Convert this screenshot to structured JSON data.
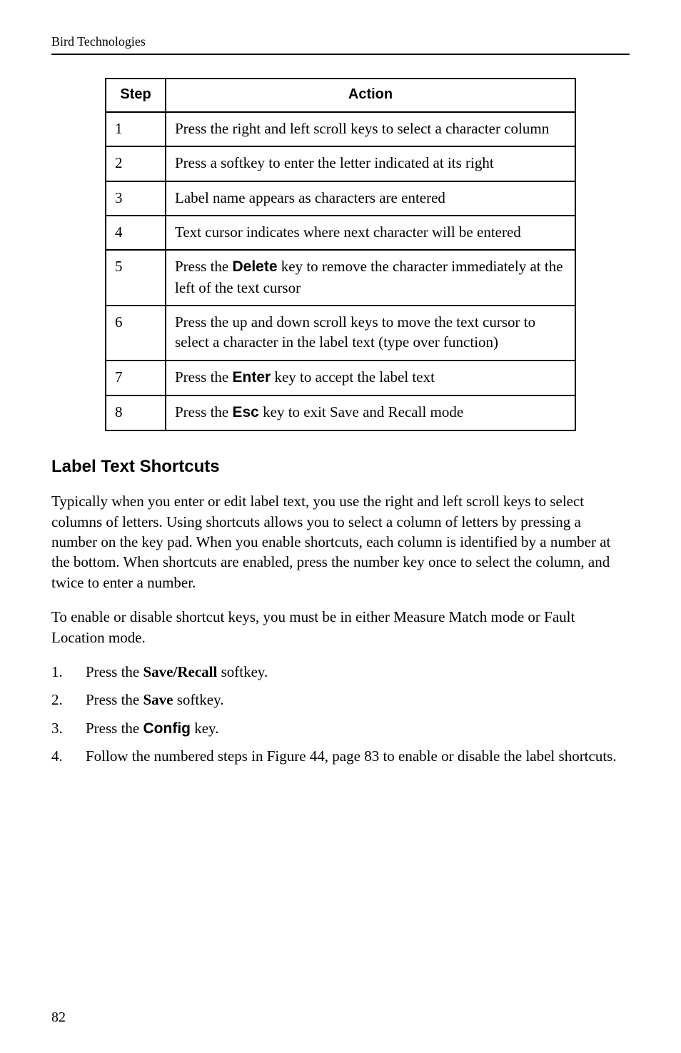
{
  "running_head": "Bird Technologies",
  "table": {
    "headers": {
      "step": "Step",
      "action": "Action"
    },
    "rows": [
      {
        "step": "1",
        "action_pre": "Press the right and left scroll keys to select a character column"
      },
      {
        "step": "2",
        "action_pre": "Press a softkey to enter the letter indicated at its right"
      },
      {
        "step": "3",
        "action_pre": "Label name appears as characters are entered"
      },
      {
        "step": "4",
        "action_pre": "Text cursor indicates where next character will be entered"
      },
      {
        "step": "5",
        "action_pre": "Press the ",
        "action_key": "Delete",
        "action_post": " key to remove the character immediately at the left of the text cursor"
      },
      {
        "step": "6",
        "action_pre": "Press the up and down scroll keys to move the text cursor to select a character in the label text (type over function)"
      },
      {
        "step": "7",
        "action_pre": "Press the ",
        "action_key": "Enter",
        "action_post": " key to accept the label text"
      },
      {
        "step": "8",
        "action_pre": "Press the ",
        "action_key": "Esc",
        "action_post": " key to exit Save and Recall mode"
      }
    ]
  },
  "section_heading": "Label Text Shortcuts",
  "para1": "Typically when you enter or edit label text, you use the right and left scroll keys to select columns of letters. Using shortcuts allows you to select a column of letters by pressing a number on the key pad. When you enable shortcuts, each column is identified by a number at the bottom. When shortcuts are enabled, press the number key once to select the column, and twice to enter a number.",
  "para2": "To enable or disable shortcut keys, you must be in either Measure Match mode or Fault Location mode.",
  "list": {
    "i1": {
      "pre": "Press the ",
      "key": "Save/Recall",
      "post": " softkey."
    },
    "i2": {
      "pre": "Press the ",
      "key": "Save",
      "post": " softkey."
    },
    "i3": {
      "pre": "Press the ",
      "key": "Config",
      "post": " key."
    },
    "i4": "Follow the numbered steps in Figure 44, page 83 to enable or disable the label shortcuts."
  },
  "page_number": "82"
}
